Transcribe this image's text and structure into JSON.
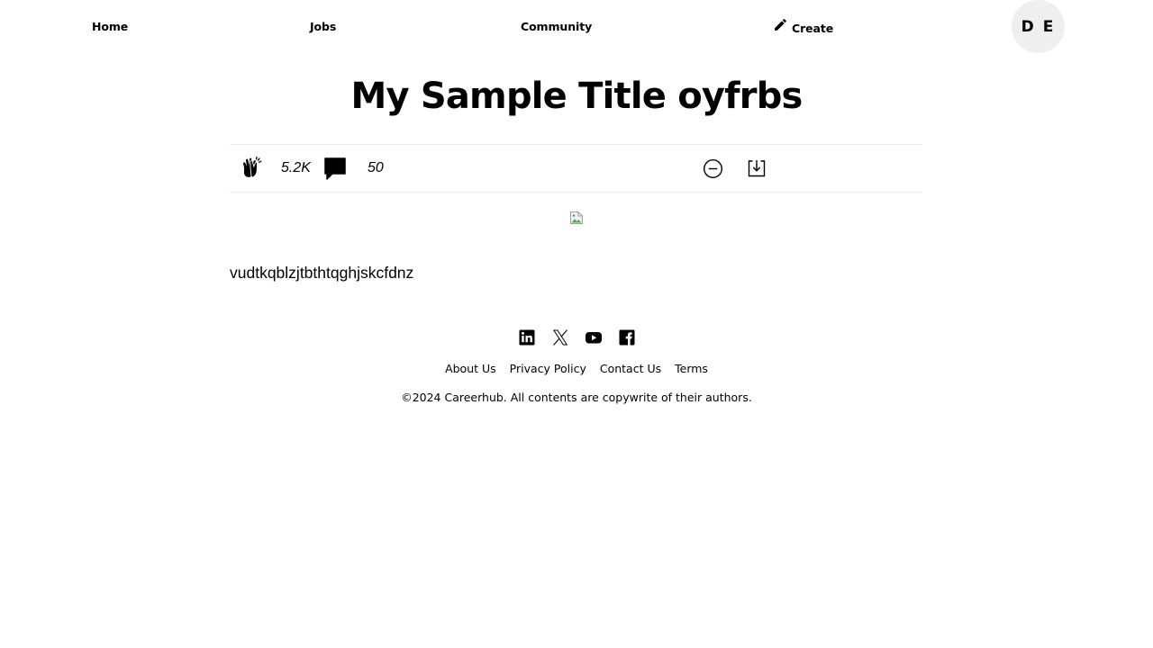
{
  "nav": {
    "home_label": "Home",
    "jobs_label": "Jobs",
    "community_label": "Community",
    "create_label": "Create",
    "create_icon": "pencil-icon",
    "avatar_initials": "D E"
  },
  "article": {
    "title": "My Sample Title oyfrbs",
    "clap_count": "5.2K",
    "comment_count": "50",
    "body": "vudtkqblzjtbthtqghjskcfdnz",
    "icons": [
      "clap-icon",
      "comment-icon",
      "remove-circle-icon",
      "save-download-icon",
      "broken-image-icon"
    ]
  },
  "footer": {
    "social_icons": [
      "linkedin-icon",
      "x-icon",
      "youtube-icon",
      "facebook-icon"
    ],
    "links": [
      "About Us",
      "Privacy Policy",
      "Contact Us",
      "Terms"
    ],
    "copyright": "©2024 Careerhub. All contents are copywrite of their authors."
  },
  "colors": {
    "background": "#ffffff",
    "text": "#000000",
    "avatar_bg": "#efefef",
    "divider": "#ececec"
  }
}
